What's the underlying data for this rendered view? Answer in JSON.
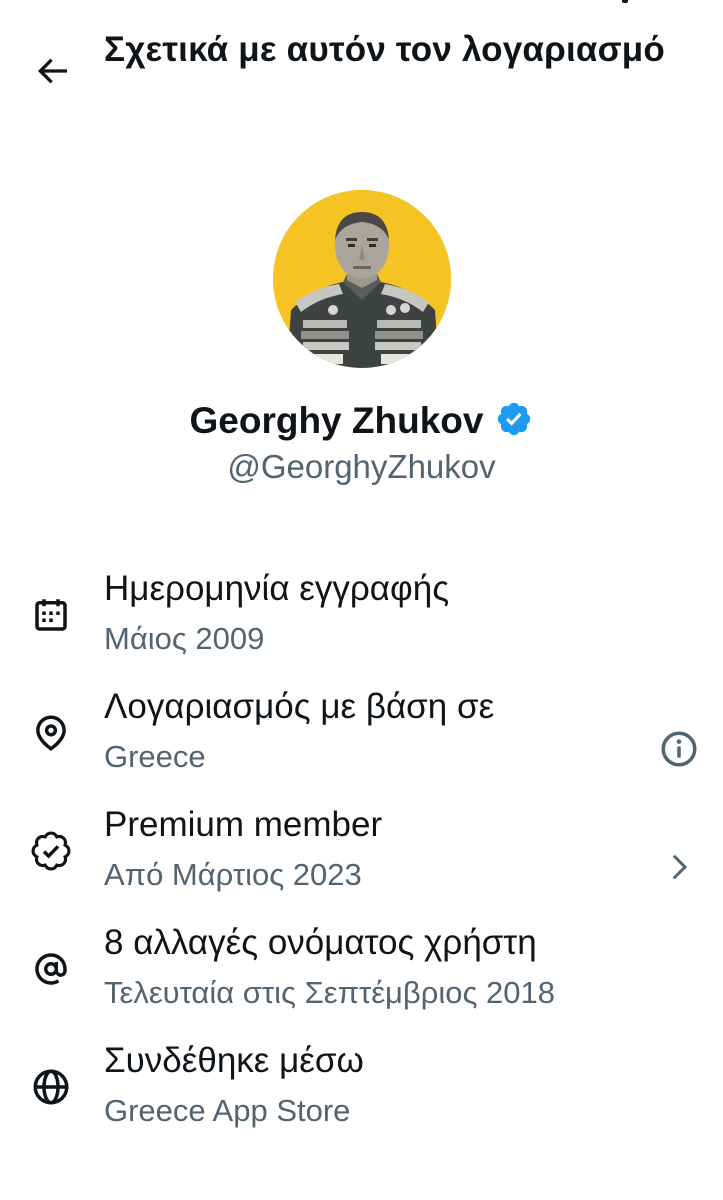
{
  "header": {
    "title": "Σχετικά με αυτόν τον λογαριασμό",
    "back_icon": "arrow-left-icon"
  },
  "profile": {
    "display_name": "Georghy Zhukov",
    "handle": "@GeorghyZhukov",
    "verified": true,
    "verified_icon": "verified-badge-icon",
    "avatar_background": "#f6c324"
  },
  "info_items": [
    {
      "icon": "calendar-icon",
      "title": "Ημερομηνία εγγραφής",
      "subtitle": "Μάιος 2009"
    },
    {
      "icon": "location-pin-icon",
      "title": "Λογαριασμός με βάση σε",
      "subtitle": "Greece",
      "trailing_icon": "info-icon"
    },
    {
      "icon": "verified-outline-icon",
      "title": "Premium member",
      "subtitle": "Από Μάρτιος 2023",
      "trailing_icon": "chevron-right-icon"
    },
    {
      "icon": "at-sign-icon",
      "title": "8 αλλαγές ονόματος χρήστη",
      "subtitle": "Τελευταία στις Σεπτέμβριος 2018"
    },
    {
      "icon": "globe-icon",
      "title": "Συνδέθηκε μέσω",
      "subtitle": "Greece App Store"
    }
  ],
  "colors": {
    "primary_text": "#0f1419",
    "secondary_text": "#536471",
    "verified_blue": "#1d9bf0",
    "background": "#ffffff"
  }
}
